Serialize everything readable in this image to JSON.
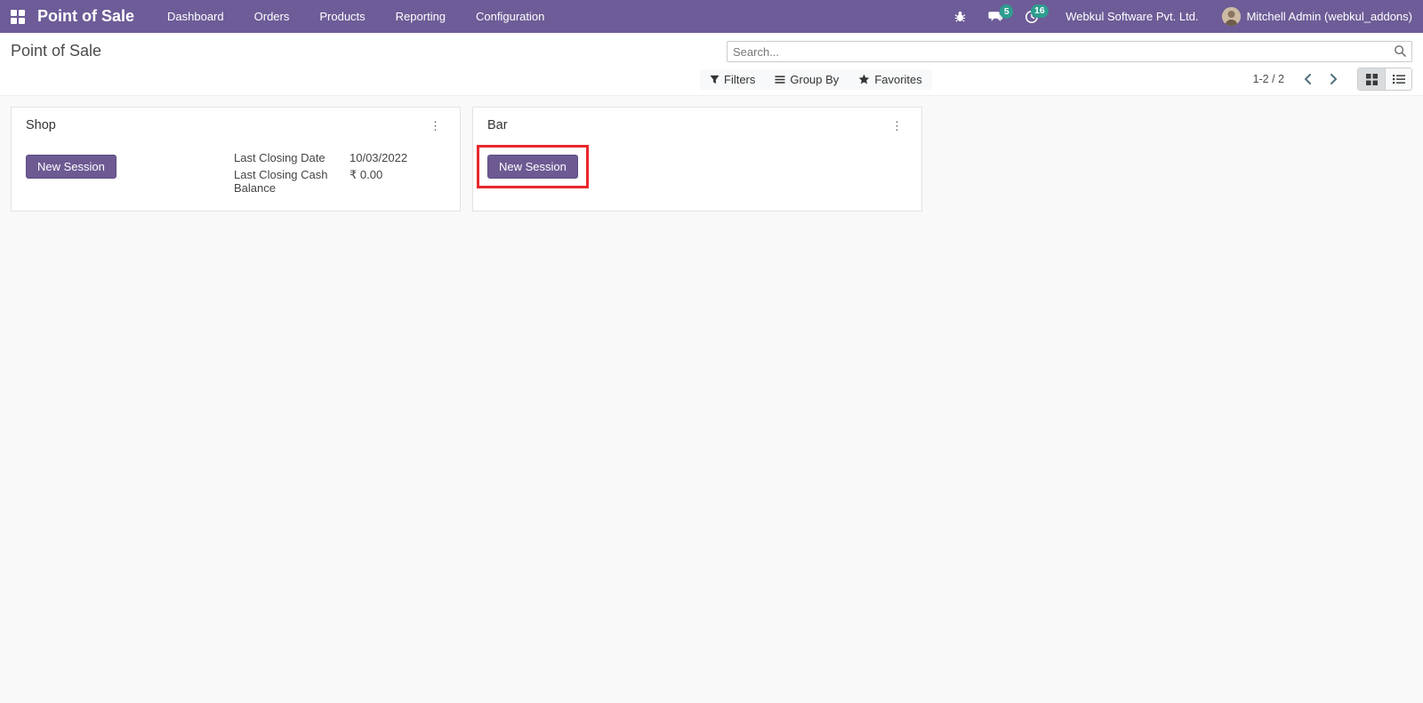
{
  "navbar": {
    "app_title": "Point of Sale",
    "menu": [
      "Dashboard",
      "Orders",
      "Products",
      "Reporting",
      "Configuration"
    ],
    "messages_badge": "5",
    "activities_badge": "16",
    "company_name": "Webkul Software Pvt. Ltd.",
    "user_name": "Mitchell Admin (webkul_addons)"
  },
  "control_panel": {
    "breadcrumb": "Point of Sale",
    "search": {
      "placeholder": "Search..."
    },
    "filters_label": "Filters",
    "group_by_label": "Group By",
    "favorites_label": "Favorites",
    "pager_text": "1-2 / 2"
  },
  "kanban": {
    "cards": [
      {
        "title": "Shop",
        "new_session_label": "New Session",
        "fields": [
          {
            "label": "Last Closing Date",
            "value": "10/03/2022"
          },
          {
            "label": "Last Closing Cash Balance",
            "value": "₹ 0.00"
          }
        ]
      },
      {
        "title": "Bar",
        "new_session_label": "New Session"
      }
    ]
  },
  "colors": {
    "navbar_bg": "#6d5c97",
    "primary_button_bg": "#6d5a93",
    "badge_bg": "#2d9d8f",
    "annotation_red": "#e8272c"
  }
}
